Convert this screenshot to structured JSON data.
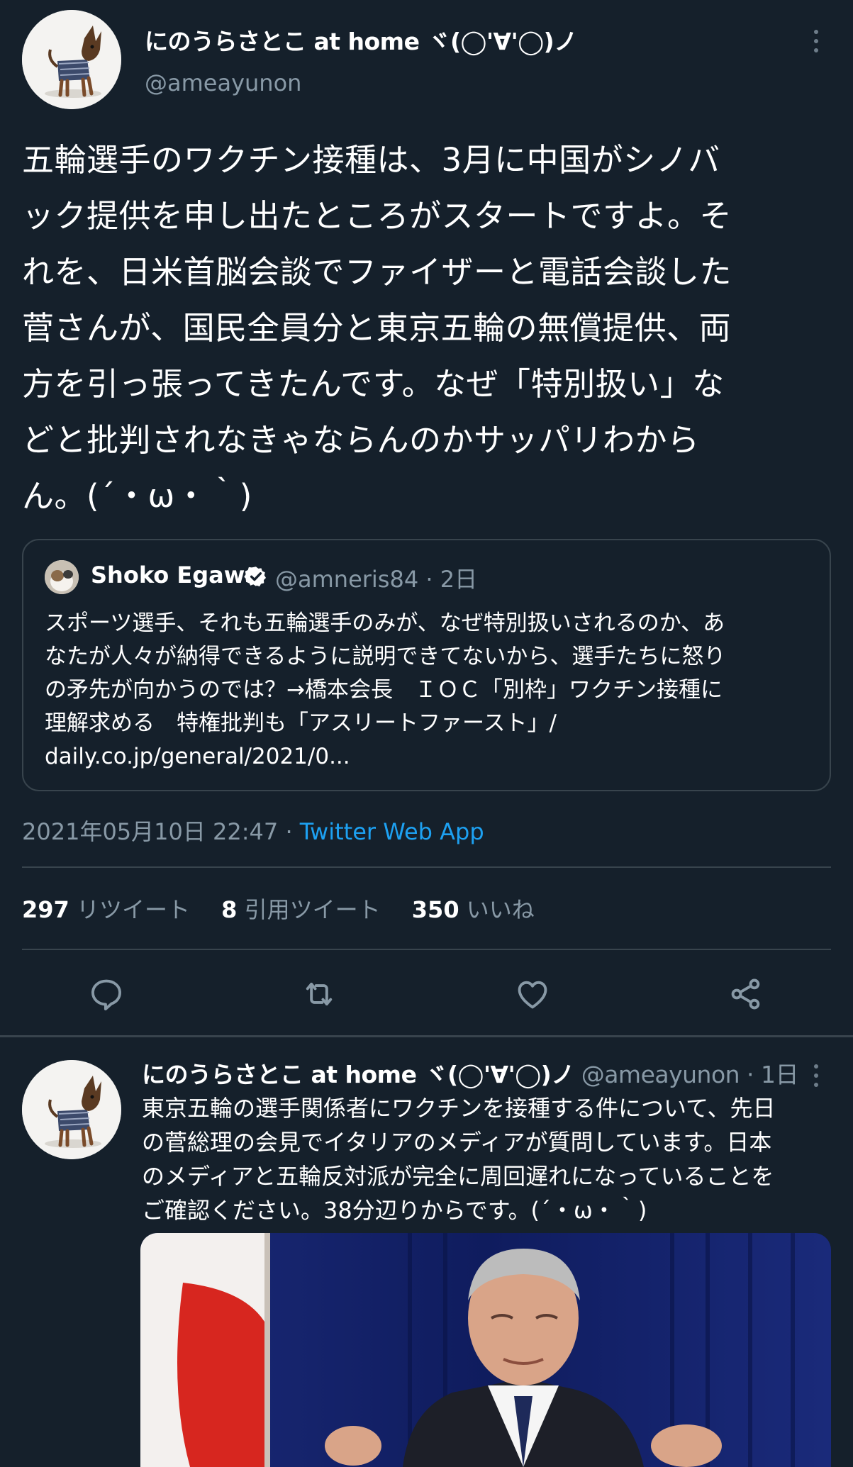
{
  "main_tweet": {
    "display_name": "にのうらさとこ at home ヾ(◯'∀'◯)ノ",
    "handle": "@ameayunon",
    "text": "五輪選手のワクチン接種は、3月に中国がシノバ\nック提供を申し出たところがスタートですよ。そ\nれを、日米首脳会談でファイザーと電話会談した\n菅さんが、国民全員分と東京五輪の無償提供、両\n方を引っ張ってきたんです。なぜ「特別扱い」な\nどと批判されなきゃならんのかサッパリわから\nん。(´・ω・｀)",
    "quote": {
      "name": "Shoko Egawa",
      "handle_time": "@amneris84 · 2日",
      "text": "スポーツ選手、それも五輪選手のみが、なぜ特別扱いされるのか、あ\nなたが人々が納得できるように説明できてないから、選手たちに怒り\nの矛先が向かうのでは？→橋本会長　ＩＯＣ「別枠」ワクチン接種に\n理解求める　特権批判も「アスリートファースト」/\n daily.co.jp/general/2021/0..."
    },
    "timestamp": "2021年05月10日 22:47 · ",
    "source": "Twitter Web App",
    "stats": {
      "retweets_count": "297",
      "retweets_label": "リツイート",
      "quotes_count": "8",
      "quotes_label": "引用ツイート",
      "likes_count": "350",
      "likes_label": "いいね"
    },
    "actions": [
      "reply-icon",
      "retweet-icon",
      "like-icon",
      "share-icon"
    ]
  },
  "second_tweet": {
    "display_name": "にのうらさとこ at home ヾ(◯'∀'◯)ノ",
    "meta": " @ameayunon · 1日",
    "text": "東京五輪の選手関係者にワクチンを接種する件について、先日\nの菅総理の会見でイタリアのメディアが質問しています。日本\nのメディアと五輪反対派が完全に周回遅れになっていることを\nご確認ください。38分辺りからです。(´・ω・｀)"
  },
  "colors": {
    "background": "#15202b",
    "border": "#38444d",
    "secondary_text": "#8899a6",
    "link": "#1da1f2",
    "verified": "#ffffff"
  }
}
